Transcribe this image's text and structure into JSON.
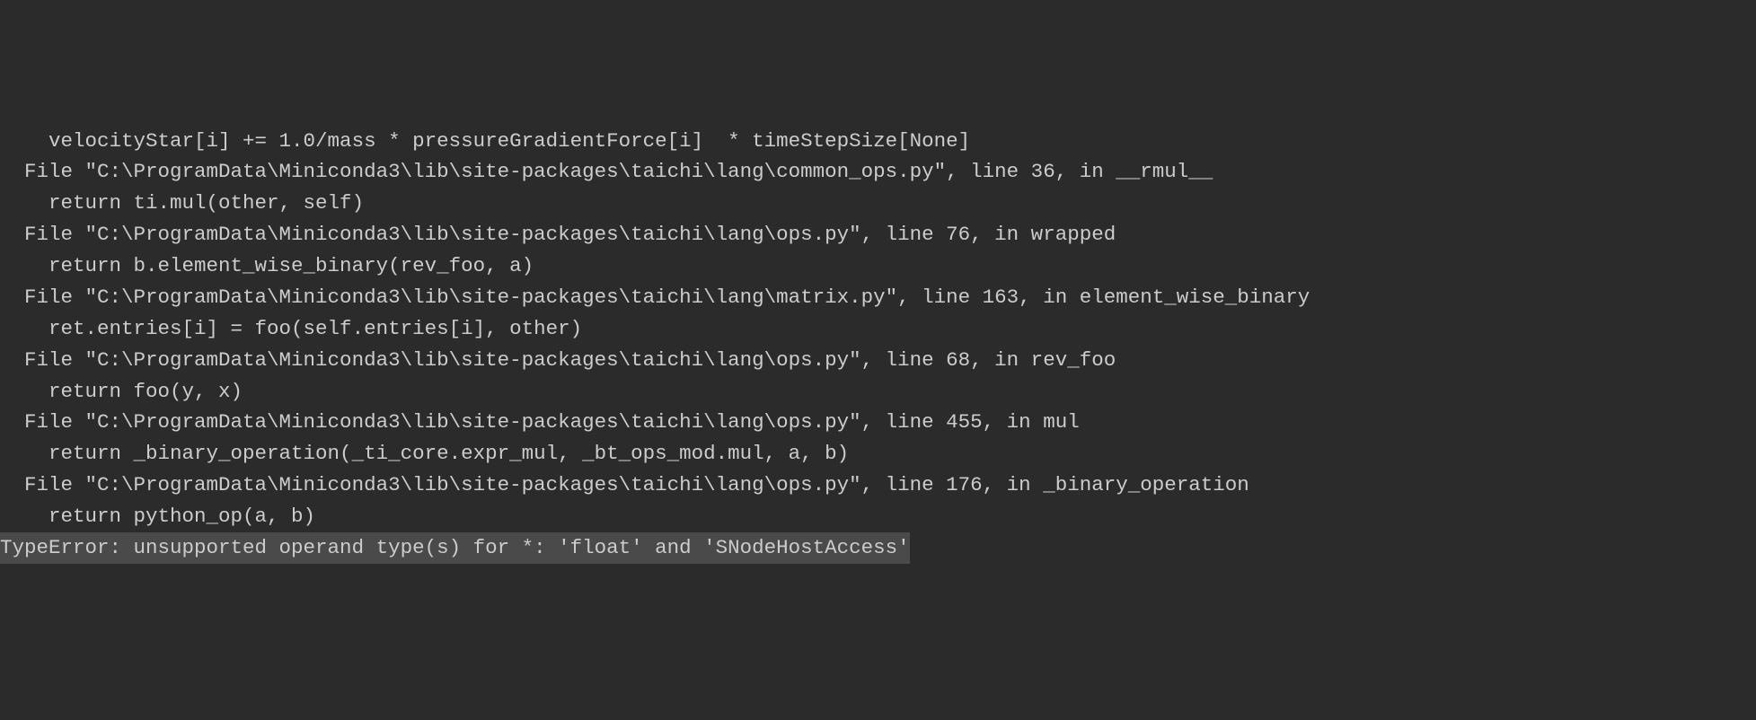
{
  "traceback": {
    "frames": [
      {
        "code_line": "    velocityStar[i] += 1.0/mass * pressureGradientForce[i]  * timeStepSize[None]",
        "file_line": "  File \"C:\\ProgramData\\Miniconda3\\lib\\site-packages\\taichi\\lang\\common_ops.py\", line 36, in __rmul__",
        "next_code": "    return ti.mul(other, self)"
      },
      {
        "file_line": "  File \"C:\\ProgramData\\Miniconda3\\lib\\site-packages\\taichi\\lang\\ops.py\", line 76, in wrapped",
        "next_code": "    return b.element_wise_binary(rev_foo, a)"
      },
      {
        "file_line": "  File \"C:\\ProgramData\\Miniconda3\\lib\\site-packages\\taichi\\lang\\matrix.py\", line 163, in element_wise_binary",
        "next_code": "    ret.entries[i] = foo(self.entries[i], other)"
      },
      {
        "file_line": "  File \"C:\\ProgramData\\Miniconda3\\lib\\site-packages\\taichi\\lang\\ops.py\", line 68, in rev_foo",
        "next_code": "    return foo(y, x)"
      },
      {
        "file_line": "  File \"C:\\ProgramData\\Miniconda3\\lib\\site-packages\\taichi\\lang\\ops.py\", line 455, in mul",
        "next_code": "    return _binary_operation(_ti_core.expr_mul, _bt_ops_mod.mul, a, b)"
      },
      {
        "file_line": "  File \"C:\\ProgramData\\Miniconda3\\lib\\site-packages\\taichi\\lang\\ops.py\", line 176, in _binary_operation",
        "next_code": "    return python_op(a, b)"
      }
    ],
    "error": "TypeError: unsupported operand type(s) for *: 'float' and 'SNodeHostAccess'"
  }
}
